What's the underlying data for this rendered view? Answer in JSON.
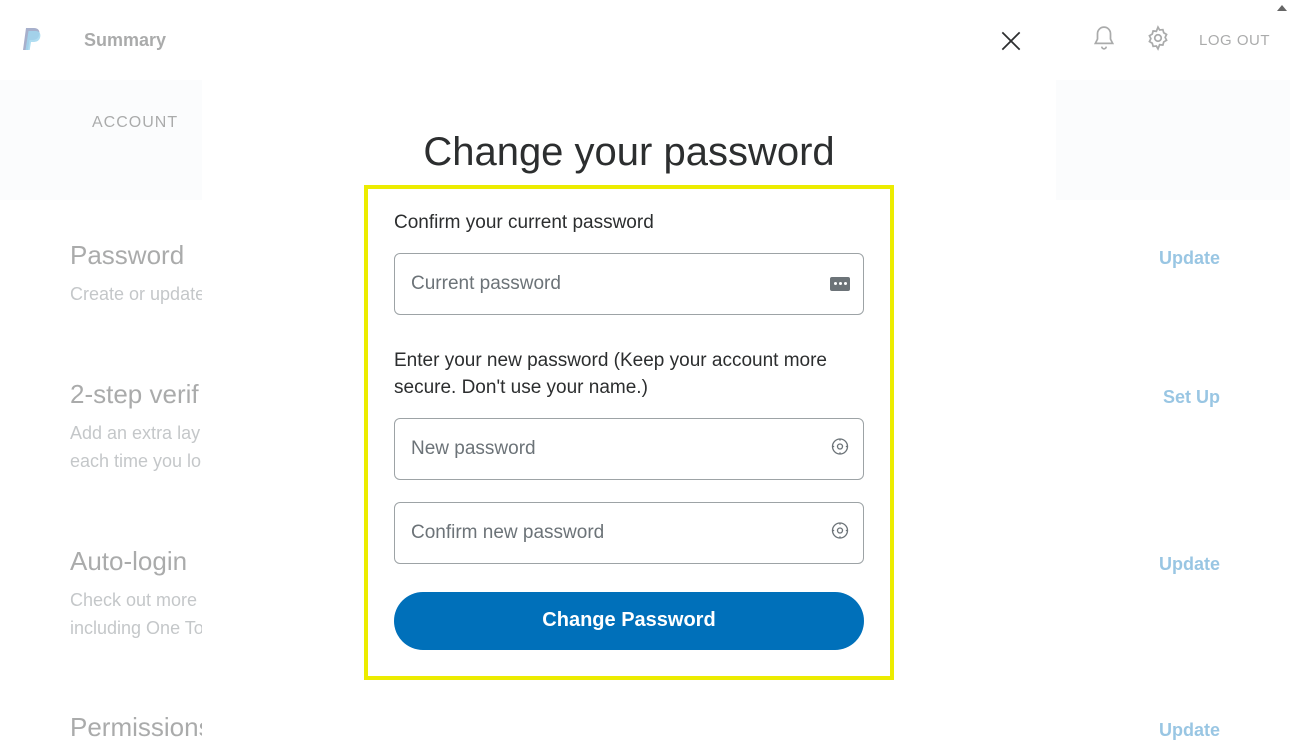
{
  "header": {
    "nav_summary": "Summary",
    "logout": "LOG OUT"
  },
  "subnav": {
    "account": "ACCOUNT"
  },
  "sections": {
    "password": {
      "title": "Password",
      "desc": "Create or update",
      "action": "Update"
    },
    "twostep": {
      "title": "2-step verif",
      "desc": "Add an extra lay\neach time you lo",
      "action": "Set Up"
    },
    "autologin": {
      "title": "Auto-login",
      "desc": "Check out more\nincluding One To",
      "action": "Update"
    },
    "permissions": {
      "title": "Permissions",
      "action": "Update"
    }
  },
  "modal": {
    "title": "Change your password",
    "label_current": "Confirm your current password",
    "placeholder_current": "Current password",
    "label_new": "Enter your new password (Keep your account more secure. Don't use your name.)",
    "placeholder_new": "New password",
    "placeholder_confirm": "Confirm new password",
    "button": "Change Password"
  }
}
